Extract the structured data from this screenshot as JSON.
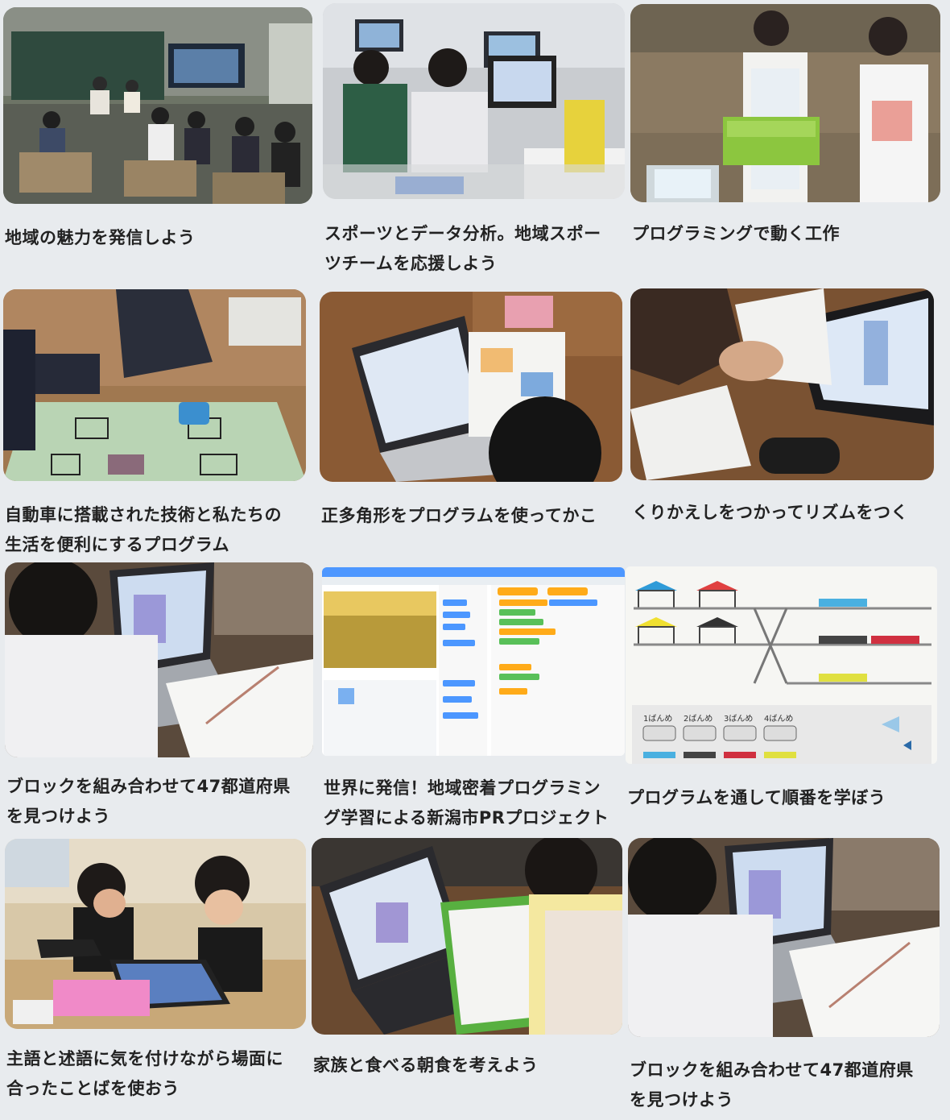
{
  "cards": [
    {
      "title_l1": "地域の魅力を発信しよう",
      "title_l2": "",
      "photo": "classroom-presentation-photo"
    },
    {
      "title_l1": "スポーツとデータ分析。地域スポー",
      "title_l2": "ツチームを応援しよう",
      "photo": "students-laptops-photo"
    },
    {
      "title_l1": "プログラミングで動く工作",
      "title_l2": "",
      "photo": "kids-craft-photo"
    },
    {
      "title_l1": "自動車に搭載された技術と私たちの",
      "title_l2": "生活を便利にするプログラム",
      "photo": "robot-car-mat-photo"
    },
    {
      "title_l1": "正多角形をプログラムを使ってかこ",
      "title_l2": "",
      "photo": "student-laptop-scratch-photo"
    },
    {
      "title_l1": "くりかえしをつかってリズムをつく",
      "title_l2": "",
      "photo": "tablet-rhythm-cards-photo"
    },
    {
      "title_l1": "ブロックを組み合わせて47都道府県",
      "title_l2": "を見つけよう",
      "photo": "student-map-laptop-photo"
    },
    {
      "title_l1": "世界に発信！地域密着プログラミン",
      "title_l2": "グ学習による新潟市PRプロジェクト",
      "photo": "scratch-editor-screenshot"
    },
    {
      "title_l1": "プログラムを通して順番を学ぼう",
      "title_l2": "",
      "photo": "train-station-app-screenshot",
      "order_labels": [
        "1ばんめ",
        "2ばんめ",
        "3ばんめ",
        "4ばんめ"
      ]
    },
    {
      "title_l1": "主語と述語に気を付けながら場面に",
      "title_l2": "合ったことばを使おう",
      "photo": "kids-tablets-photo"
    },
    {
      "title_l1": "家族と食べる朝食を考えよう",
      "title_l2": "",
      "photo": "student-worksheet-laptop-photo"
    },
    {
      "title_l1": "ブロックを組み合わせて47都道府県",
      "title_l2": "を見つけよう",
      "photo": "student-map-laptop-photo-2"
    }
  ]
}
